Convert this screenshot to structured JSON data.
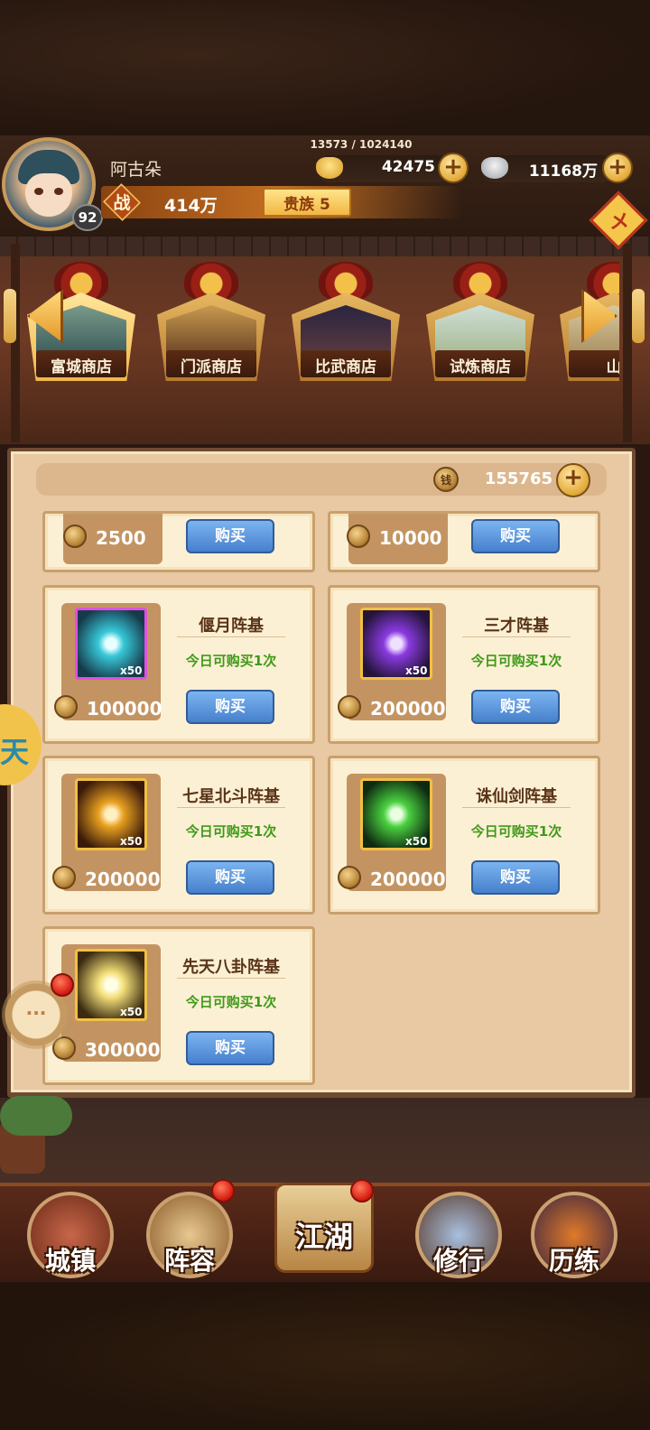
{
  "player": {
    "name": "阿古朵",
    "level": "92",
    "exp": "13573 / 1024140",
    "power_label": "战",
    "power": "414万",
    "noble": "贵族 5"
  },
  "resources": {
    "gold_ingot": "42475",
    "silver": "11168万",
    "plus": "+"
  },
  "side_icon": "メ",
  "shop_tabs": [
    {
      "label": "富城商店",
      "icon": "city-shop-icon",
      "active": true
    },
    {
      "label": "门派商店",
      "icon": "sect-shop-icon",
      "active": false
    },
    {
      "label": "比武商店",
      "icon": "duel-shop-icon",
      "active": false
    },
    {
      "label": "试炼商店",
      "icon": "trial-shop-icon",
      "active": false
    },
    {
      "label": "山",
      "icon": "mountain-shop-icon",
      "active": false
    }
  ],
  "shop": {
    "currency_value": "155765",
    "coin_glyph": "钱",
    "items": [
      {
        "name": "",
        "price": "2500",
        "buy": "购买",
        "limit": ""
      },
      {
        "name": "",
        "price": "10000",
        "buy": "购买",
        "limit": ""
      },
      {
        "name": "偃月阵基",
        "price": "100000",
        "qty": "x50",
        "limit": "今日可购买1次",
        "buy": "购买",
        "color": "#37c8d8",
        "border": "#e050e0"
      },
      {
        "name": "三才阵基",
        "price": "200000",
        "qty": "x50",
        "limit": "今日可购买1次",
        "buy": "购买",
        "color": "#8a3ae0",
        "border": "#f2c042"
      },
      {
        "name": "七星北斗阵基",
        "price": "200000",
        "qty": "x50",
        "limit": "今日可购买1次",
        "buy": "购买",
        "color": "#e8a020",
        "border": "#f2c042"
      },
      {
        "name": "诛仙剑阵基",
        "price": "200000",
        "qty": "x50",
        "limit": "今日可购买1次",
        "buy": "购买",
        "color": "#4ad040",
        "border": "#f2c042"
      },
      {
        "name": "先天八卦阵基",
        "price": "300000",
        "qty": "x50",
        "limit": "今日可购买1次",
        "buy": "购买",
        "color": "#f4e07a",
        "border": "#f2c042"
      }
    ]
  },
  "float": {
    "side_text": "天",
    "chat": "···"
  },
  "nav": [
    {
      "label": "城镇",
      "icon": "town-icon"
    },
    {
      "label": "阵容",
      "icon": "lineup-icon",
      "badge": true
    },
    {
      "label": "江湖",
      "icon": "jianghu-scroll-icon",
      "badge": true
    },
    {
      "label": "修行",
      "icon": "cultivation-icon"
    },
    {
      "label": "历练",
      "icon": "training-icon"
    }
  ]
}
